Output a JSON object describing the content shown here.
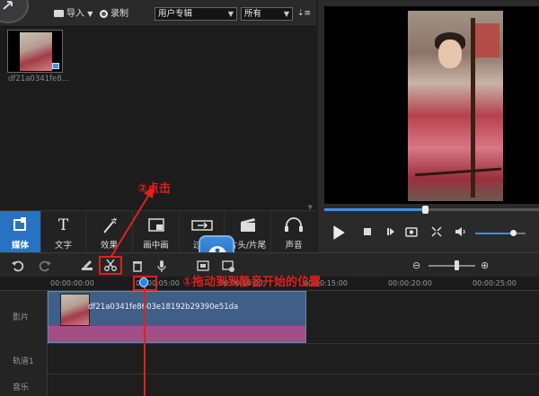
{
  "toolbar": {
    "import_label": "导入",
    "record_label": "录制",
    "category_value": "用户专辑",
    "filter_value": "所有",
    "sort_icon": "sort-icon"
  },
  "library": {
    "items": [
      {
        "name": "df21a0341fe8..."
      }
    ]
  },
  "categories": [
    {
      "label": "媒体",
      "icon": "film-strip-icon"
    },
    {
      "label": "文字",
      "icon": "text-t-icon"
    },
    {
      "label": "效果",
      "icon": "magic-wand-icon"
    },
    {
      "label": "画中画",
      "icon": "pip-icon"
    },
    {
      "label": "过渡",
      "icon": "transition-icon"
    },
    {
      "label": "片头/片尾",
      "icon": "clapper-icon"
    },
    {
      "label": "声音",
      "icon": "headphones-icon"
    }
  ],
  "preview": {
    "progress": 0.47,
    "volume": 0.75
  },
  "timeline": {
    "zoom": 0.6,
    "ruler_labels": [
      "00:00:00:00",
      "00:00:05:00",
      "00:00:10:00",
      "00:00:15:00",
      "00:00:20:00",
      "00:00:25:00"
    ],
    "tracks": [
      {
        "label": "影片"
      },
      {
        "label": "轨道1"
      },
      {
        "label": "音乐"
      }
    ],
    "clip_name": "df21a0341fe8603e18192b29390e51da"
  },
  "annotations": {
    "click_label": "②点击",
    "drag_label": "①拖动到到静音开始的位置"
  },
  "colors": {
    "accent": "#2872c4",
    "annotation": "#e0201c",
    "clip": "#3f5e88",
    "audio": "#a34e86"
  }
}
